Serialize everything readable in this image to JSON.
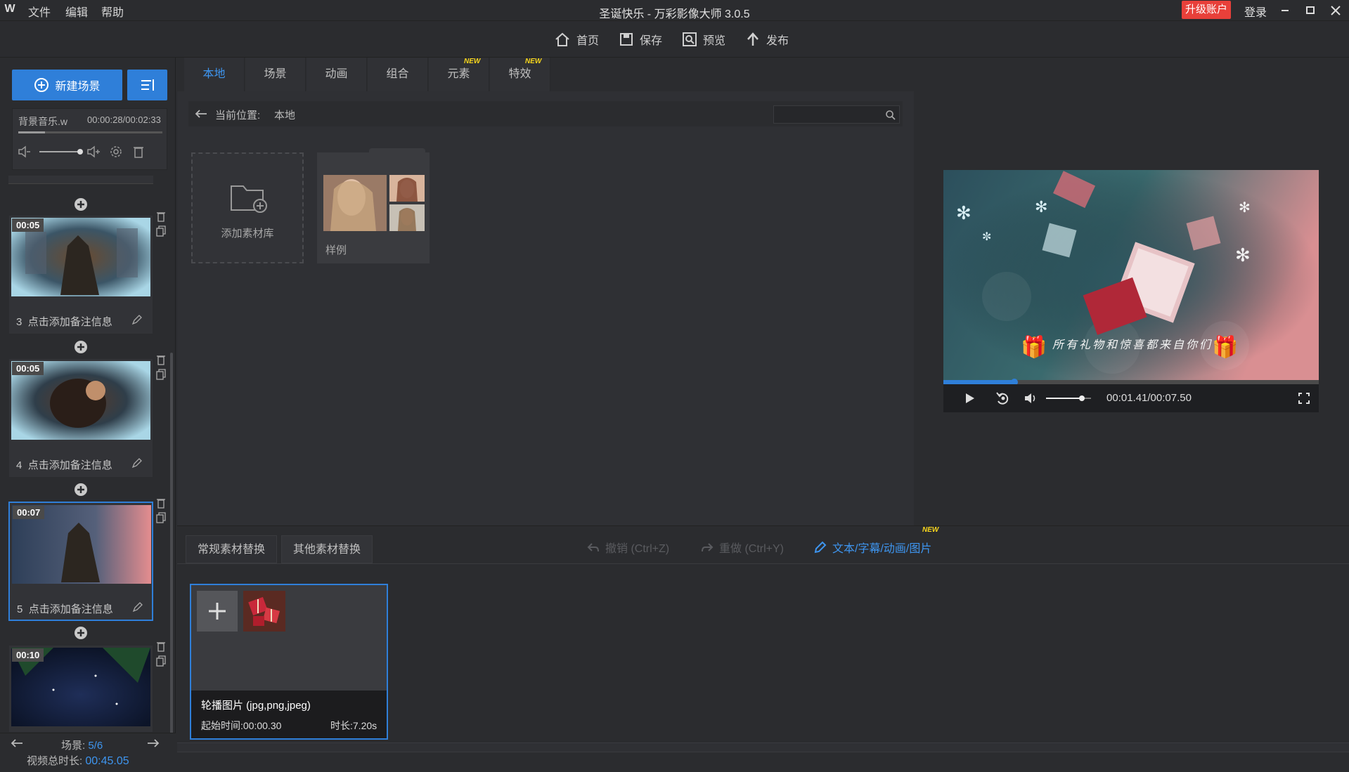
{
  "titlebar": {
    "logo": "W",
    "menus": [
      "文件",
      "编辑",
      "帮助"
    ],
    "title": "圣诞快乐 - 万彩影像大师 3.0.5",
    "upgrade": "升级账户",
    "login": "登录"
  },
  "toolbar": {
    "home": "首页",
    "save": "保存",
    "preview": "预览",
    "publish": "发布"
  },
  "left": {
    "new_scene": "新建场景",
    "music": {
      "name": "背景音乐.w",
      "time": "00:00:28/00:02:33"
    },
    "scenes": [
      {
        "duration": "00:05",
        "index": "3",
        "note": "点击添加备注信息"
      },
      {
        "duration": "00:05",
        "index": "4",
        "note": "点击添加备注信息"
      },
      {
        "duration": "00:07",
        "index": "5",
        "note": "点击添加备注信息"
      },
      {
        "duration": "00:10",
        "index": "",
        "note": ""
      }
    ],
    "footer": {
      "scene_label": "场景:",
      "scene_value": "5/6",
      "total_label": "视频总时长:",
      "total_value": "00:45.05"
    }
  },
  "materials": {
    "tabs": [
      "本地",
      "场景",
      "动画",
      "组合",
      "元素",
      "特效"
    ],
    "new_badge": "NEW",
    "path_label": "当前位置:",
    "path_value": "本地",
    "search_placeholder": "",
    "add_library": "添加素材库",
    "sample": "样例"
  },
  "preview": {
    "caption": "所有礼物和惊喜都来自你们",
    "time": "00:01.41/00:07.50",
    "progress": 0.19,
    "volume": 0.8
  },
  "bottom": {
    "tabs": [
      "常规素材替换",
      "其他素材替换"
    ],
    "undo": "撤销 (Ctrl+Z)",
    "redo": "重做 (Ctrl+Y)",
    "text_edit": "文本/字幕/动画/图片",
    "new_badge": "NEW",
    "asset": {
      "title": "轮播图片 (jpg,png,jpeg)",
      "start": "起始时间:00:00.30",
      "duration": "时长:7.20s"
    }
  },
  "colors": {
    "accent": "#2f7fd9",
    "active_tab": "#3e95ef",
    "upgrade": "#e8403a",
    "new_badge": "#f8d61c"
  }
}
